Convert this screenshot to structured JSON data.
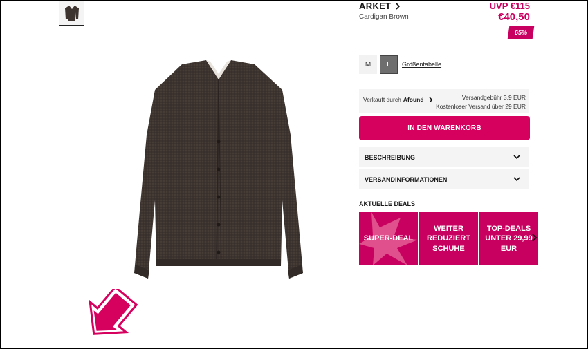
{
  "product": {
    "brand": "ARKET",
    "name": "Cardigan Brown",
    "uvp_label": "UVP",
    "uvp_price": "€115",
    "price": "€40,50",
    "discount": "65%"
  },
  "sizes": {
    "m": "M",
    "l": "L",
    "chart_link": "Größentabelle"
  },
  "seller": {
    "prefix": "Verkauft durch",
    "name": "Afound",
    "shipping_fee": "Versandgebühr 3,9 EUR",
    "free_shipping": "Kostenloser Versand über 29 EUR"
  },
  "cart_button": "IN DEN WARENKORB",
  "accordion": {
    "description": "BESCHREIBUNG",
    "shipping": "VERSANDINFORMATIONEN"
  },
  "deals": {
    "title": "AKTUELLE DEALS",
    "items": [
      "SUPER-DEAL",
      "WEITER REDUZIERT SCHUHE",
      "TOP-DEALS UNTER 29,99 EUR"
    ]
  },
  "badge": {
    "text": "WEITER REDUZIERT"
  },
  "colors": {
    "accent": "#d6005f",
    "cardigan": "#3d3430"
  }
}
